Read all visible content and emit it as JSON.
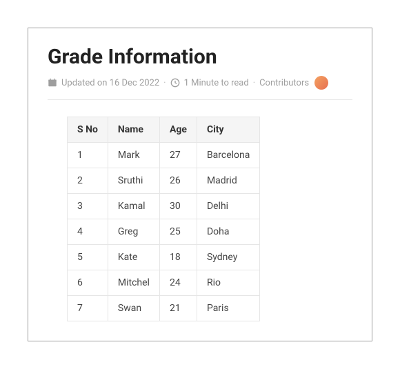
{
  "title": "Grade Information",
  "meta": {
    "updated": "Updated on 16 Dec 2022",
    "read_time": "1 Minute to read",
    "contributors_label": "Contributors"
  },
  "table": {
    "headers": {
      "sno": "S No",
      "name": "Name",
      "age": "Age",
      "city": "City"
    },
    "rows": [
      {
        "sno": "1",
        "name": "Mark",
        "age": "27",
        "city": "Barcelona"
      },
      {
        "sno": "2",
        "name": "Sruthi",
        "age": "26",
        "city": "Madrid"
      },
      {
        "sno": "3",
        "name": "Kamal",
        "age": "30",
        "city": "Delhi"
      },
      {
        "sno": "4",
        "name": "Greg",
        "age": "25",
        "city": "Doha"
      },
      {
        "sno": "5",
        "name": "Kate",
        "age": "18",
        "city": "Sydney"
      },
      {
        "sno": "6",
        "name": "Mitchel",
        "age": "24",
        "city": "Rio"
      },
      {
        "sno": "7",
        "name": "Swan",
        "age": "21",
        "city": "Paris"
      }
    ]
  }
}
